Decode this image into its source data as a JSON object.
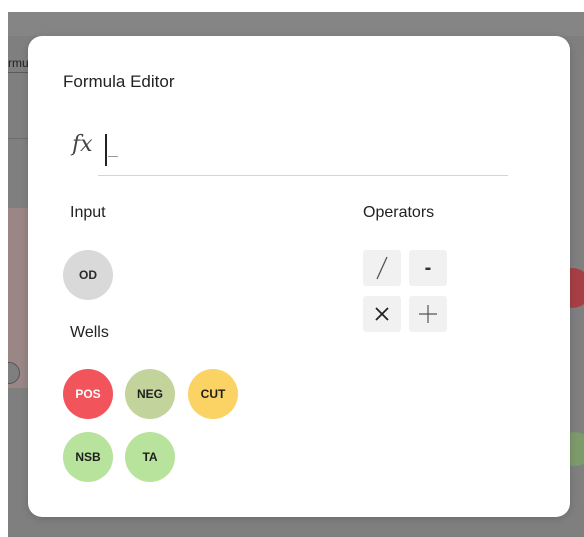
{
  "background": {
    "label_fragment": "rmu"
  },
  "modal": {
    "title": "Formula Editor",
    "formula": {
      "prefix_glyph": "fx",
      "value": "",
      "placeholder": ""
    },
    "input_section": {
      "label": "Input",
      "chips": [
        {
          "label": "OD",
          "color": "#d9d9d9",
          "text_color": "#2a2a2a"
        }
      ]
    },
    "wells_section": {
      "label": "Wells",
      "chips": [
        {
          "label": "POS",
          "color": "#f2545b",
          "text_color": "#ffffff"
        },
        {
          "label": "NEG",
          "color": "#c2d39b",
          "text_color": "#1e1e1e"
        },
        {
          "label": "CUT",
          "color": "#fbd264",
          "text_color": "#1e1e1e"
        },
        {
          "label": "NSB",
          "color": "#b7e39c",
          "text_color": "#1e1e1e"
        },
        {
          "label": "TA",
          "color": "#b7e39c",
          "text_color": "#1e1e1e"
        }
      ]
    },
    "operators_section": {
      "label": "Operators",
      "buttons": [
        {
          "op": "divide",
          "icon": "slash-icon"
        },
        {
          "op": "subtract",
          "label": "-",
          "icon": "minus-icon"
        },
        {
          "op": "multiply",
          "icon": "times-icon"
        },
        {
          "op": "add",
          "icon": "plus-icon"
        }
      ]
    }
  }
}
